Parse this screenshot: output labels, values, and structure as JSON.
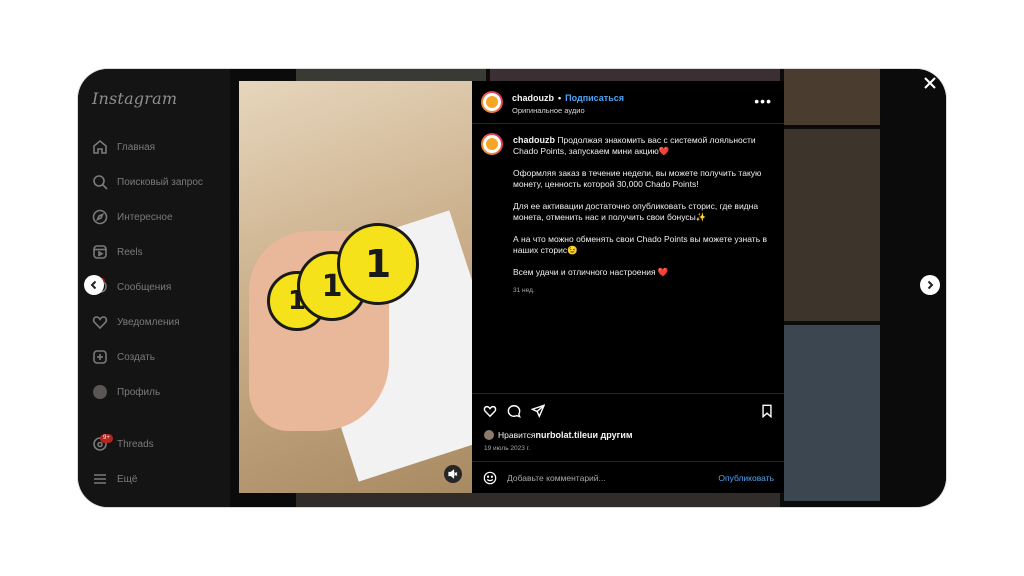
{
  "sidebar": {
    "logo": "Instagram",
    "items": [
      {
        "label": "Главная",
        "icon": "home-icon"
      },
      {
        "label": "Поисковый запрос",
        "icon": "search-icon"
      },
      {
        "label": "Интересное",
        "icon": "compass-icon"
      },
      {
        "label": "Reels",
        "icon": "reels-icon"
      },
      {
        "label": "Сообщения",
        "icon": "messenger-icon"
      },
      {
        "label": "Уведомления",
        "icon": "heart-icon"
      },
      {
        "label": "Создать",
        "icon": "plus-square-icon"
      },
      {
        "label": "Профиль",
        "icon": "avatar"
      },
      {
        "label": "Threads",
        "icon": "threads-icon",
        "badge": "9+"
      },
      {
        "label": "Ещё",
        "icon": "menu-icon"
      }
    ]
  },
  "media": {
    "coin_text": "1",
    "mute_icon": "volume-off-icon"
  },
  "post": {
    "username": "chadouzb",
    "separator": "•",
    "follow_label": "Подписаться",
    "audio_label": "Оригинальное аудио",
    "caption_first": "Продолжая знакомить вас с системой лояльности Chado Points, запускаем мини акцию❤️",
    "caption_paragraphs": [
      "Оформляя заказ в течение недели, вы можете получить такую монету, ценность которой 30,000 Chado Points!",
      "Для ее активации достаточно опубликовать сторис, где видна монета, отменить нас и получить свои бонусы✨",
      "А на что можно обменять свои Chado Points вы можете узнать в наших сторис😉",
      "Всем удачи и отличного настроения ❤️"
    ],
    "caption_time": "31 нед.",
    "likes_prefix": "Нравится ",
    "likes_user": "nurbolat.tileu",
    "likes_suffix": " и другим",
    "date": "19 июль 2023 г.",
    "comment_placeholder": "Добавьте комментарий...",
    "publish_label": "Опубликовать"
  },
  "colors": {
    "accent": "#4da3f5",
    "background": "#000000",
    "sidebar": "#141414"
  }
}
